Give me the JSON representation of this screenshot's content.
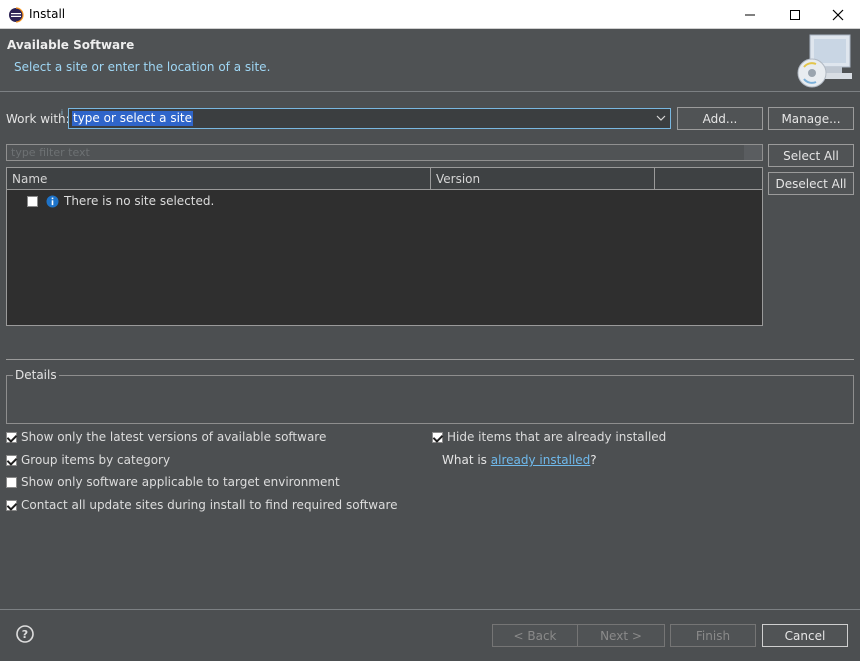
{
  "window": {
    "title": "Install",
    "controls": {
      "minimize": "minimize-icon",
      "maximize": "maximize-icon",
      "close": "close-icon"
    }
  },
  "header": {
    "title": "Available Software",
    "description": "Select a site or enter the location of a site."
  },
  "work_with": {
    "label": "Work with:",
    "value": "type or select a site",
    "add_button": "Add...",
    "manage_button": "Manage..."
  },
  "filter": {
    "placeholder": "type filter text"
  },
  "table": {
    "columns": [
      "Name",
      "Version",
      ""
    ],
    "rows": [
      {
        "checked": false,
        "icon": "info-icon",
        "text": "There is no site selected."
      }
    ]
  },
  "side_buttons": {
    "select_all": "Select All",
    "deselect_all": "Deselect All"
  },
  "details": {
    "legend": "Details"
  },
  "options": {
    "latest_versions": {
      "label": "Show only the latest versions of available software",
      "checked": true
    },
    "group_by_category": {
      "label": "Group items by category",
      "checked": true
    },
    "applicable_only": {
      "label": "Show only software applicable to target environment",
      "checked": false
    },
    "contact_all_sites": {
      "label": "Contact all update sites during install to find required software",
      "checked": true
    },
    "hide_installed": {
      "label": "Hide items that are already installed",
      "checked": true
    },
    "what_is_prefix": "What is ",
    "what_is_link": "already installed",
    "what_is_suffix": "?"
  },
  "footer": {
    "back": "< Back",
    "next": "Next >",
    "finish": "Finish",
    "cancel": "Cancel"
  },
  "colors": {
    "background": "#4c4f51",
    "selection": "#2f65ca",
    "link": "#6fb9ec",
    "description": "#9fd7f5"
  }
}
